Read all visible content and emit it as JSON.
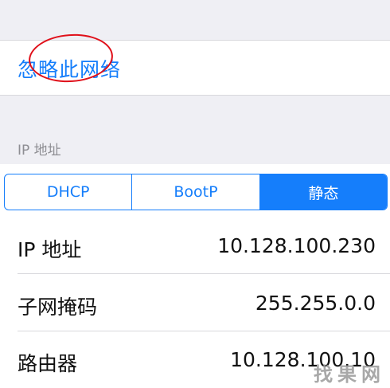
{
  "forget_network": {
    "label": "忽略此网络"
  },
  "section": {
    "header": "IP 地址"
  },
  "mode_segment": {
    "options": [
      "DHCP",
      "BootP",
      "静态"
    ],
    "selected": "静态",
    "accent_color": "#157efb"
  },
  "fields": [
    {
      "label": "IP 地址",
      "value": "10.128.100.230"
    },
    {
      "label": "子网掩码",
      "value": "255.255.0.0"
    },
    {
      "label": "路由器",
      "value": "10.128.100.10"
    }
  ],
  "watermark": {
    "text": "找果网"
  },
  "colors": {
    "annotation_circle": "#e0101a",
    "background": "#efeff4"
  }
}
